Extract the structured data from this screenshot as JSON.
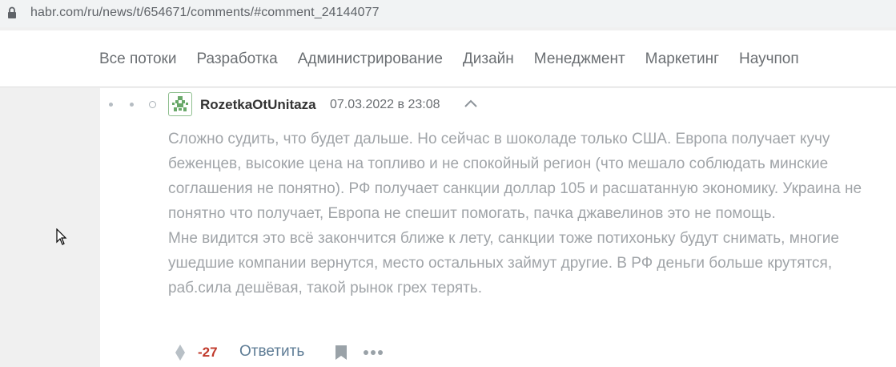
{
  "browser": {
    "url": "habr.com/ru/news/t/654671/comments/#comment_24144077"
  },
  "nav": {
    "items": [
      {
        "label": "Все потоки"
      },
      {
        "label": "Разработка"
      },
      {
        "label": "Администрирование"
      },
      {
        "label": "Дизайн"
      },
      {
        "label": "Менеджмент"
      },
      {
        "label": "Маркетинг"
      },
      {
        "label": "Научпоп"
      }
    ]
  },
  "comment": {
    "author": "RozetkaOtUnitaza",
    "timestamp": "07.03.2022 в 23:08",
    "paragraphs": [
      "Сложно судить, что будет дальше. Но сейчас в шоколаде только США. Европа получает кучу беженцев, высокие цена на топливо и не спокойный регион (что мешало соблюдать минские соглашения не понятно). РФ получает санкции доллар 105 и расшатанную экономику. Украина не понятно что получает, Европа не спешит помогать, пачка джавелинов это не помощь.",
      "Мне видится это всё закончится ближе к лету, санкции тоже потихоньку будут снимать, многие ушедшие компании вернутся, место остальных займут другие. В РФ деньги больше крутятся, раб.сила дешёвая, такой рынок грех терять."
    ],
    "score": "-27",
    "reply_label": "Ответить"
  },
  "colors": {
    "score_negative": "#c0392b",
    "reply_link": "#5e7c95",
    "avatar_green": "#6aa86a"
  },
  "icons": {
    "lock": "lock-icon",
    "avatar": "avatar-identicon",
    "collapse": "chevron-up-icon",
    "vote": "vote-icon",
    "bookmark": "bookmark-icon",
    "more": "more-dots-icon",
    "cursor": "mouse-cursor-icon"
  }
}
